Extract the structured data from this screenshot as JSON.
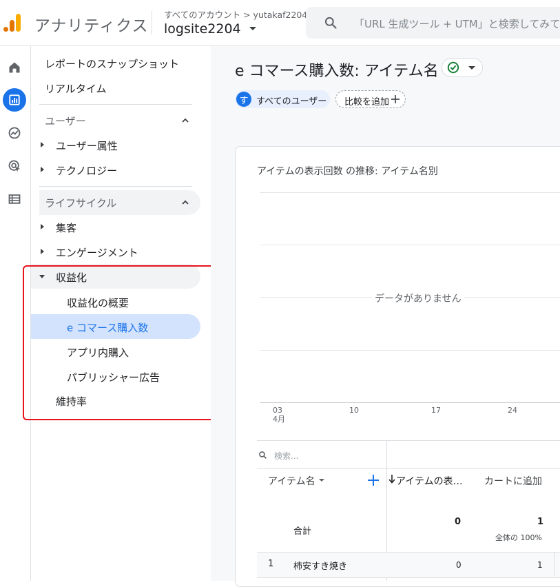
{
  "header": {
    "app_name": "アナリティクス",
    "breadcrumb": "すべてのアカウント > yutakaf2204",
    "property": "logsite2204",
    "search_placeholder": "「URL 生成ツール + UTM」と検索してみて"
  },
  "rail": {
    "items": [
      {
        "icon": "home-icon",
        "active": false
      },
      {
        "icon": "reports-icon",
        "active": true
      },
      {
        "icon": "explore-icon",
        "active": false
      },
      {
        "icon": "advertising-icon",
        "active": false
      },
      {
        "icon": "configure-icon",
        "active": false
      }
    ]
  },
  "nav": {
    "snapshot": "レポートのスナップショット",
    "realtime": "リアルタイム",
    "user_section": "ユーザー",
    "user_attributes": "ユーザー属性",
    "technology": "テクノロジー",
    "lifecycle_section": "ライフサイクル",
    "acquisition": "集客",
    "engagement": "エンゲージメント",
    "monetization": "収益化",
    "monetization_overview": "収益化の概要",
    "ecommerce": "e コマース購入数",
    "inapp": "アプリ内購入",
    "publisher_ads": "パブリッシャー広告",
    "retention": "維持率"
  },
  "main": {
    "title": "e コマース購入数: アイテム名",
    "chip_users_avatar": "す",
    "chip_users": "すべてのユーザー",
    "chip_compare": "比較を追加",
    "chart_title": "アイテムの表示回数 の推移: アイテム名別",
    "no_data": "データがありません",
    "x_ticks": [
      "03",
      "10",
      "17",
      "24"
    ],
    "x_month": "4月",
    "table": {
      "search_placeholder": "検索...",
      "col_item": "アイテム名",
      "col_views": "アイテムの表…",
      "col_cart": "カートに追加",
      "total_label": "合計",
      "total_views": "0",
      "total_cart": "1",
      "total_cart_pct": "全体の 100%",
      "rows": [
        {
          "rank": "1",
          "name": "柿安すき焼き",
          "views": "0",
          "cart": "1"
        }
      ]
    }
  },
  "colors": {
    "accent": "#1a73e8",
    "highlight_border": "#e8141c",
    "active_nav_bg": "#d3e3fd"
  }
}
